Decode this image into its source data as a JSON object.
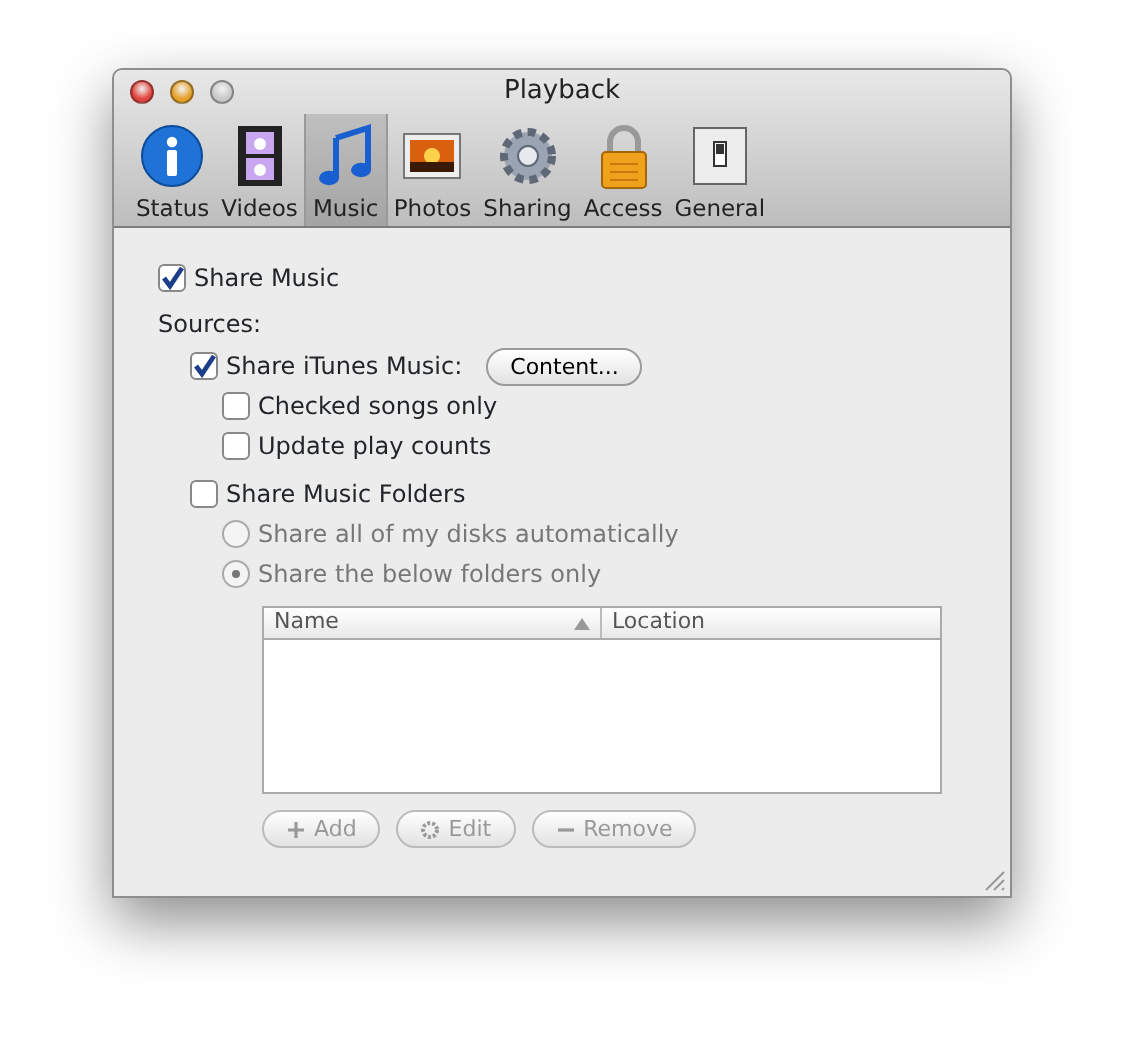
{
  "window": {
    "title": "Playback"
  },
  "tabs": [
    {
      "label": "Status",
      "selected": false
    },
    {
      "label": "Videos",
      "selected": false
    },
    {
      "label": "Music",
      "selected": true
    },
    {
      "label": "Photos",
      "selected": false
    },
    {
      "label": "Sharing",
      "selected": false
    },
    {
      "label": "Access",
      "selected": false
    },
    {
      "label": "General",
      "selected": false
    }
  ],
  "share_music": {
    "label": "Share Music",
    "checked": true
  },
  "sources_label": "Sources:",
  "sources": [
    {
      "kind": "checkbox",
      "label": "Share iTunes Music:",
      "checked": true,
      "disabled": false,
      "button": "Content...",
      "children": [
        {
          "kind": "checkbox",
          "label": "Checked songs only",
          "checked": false,
          "disabled": false
        },
        {
          "kind": "checkbox",
          "label": "Update play counts",
          "checked": false,
          "disabled": false
        }
      ]
    },
    {
      "kind": "checkbox",
      "label": "Share Music Folders",
      "checked": false,
      "disabled": false,
      "children": [
        {
          "kind": "radio",
          "label": "Share all of my disks automatically",
          "selected": false,
          "disabled": true
        },
        {
          "kind": "radio",
          "label": "Share the below folders only",
          "selected": true,
          "disabled": true
        }
      ]
    }
  ],
  "folders_table": {
    "columns": [
      {
        "label": "Name",
        "sorted": true
      },
      {
        "label": "Location",
        "sorted": false
      }
    ]
  },
  "folder_buttons": [
    {
      "kind": "add",
      "label": "Add",
      "disabled": true
    },
    {
      "kind": "edit",
      "label": "Edit",
      "disabled": true
    },
    {
      "kind": "remove",
      "label": "Remove",
      "disabled": true
    }
  ]
}
